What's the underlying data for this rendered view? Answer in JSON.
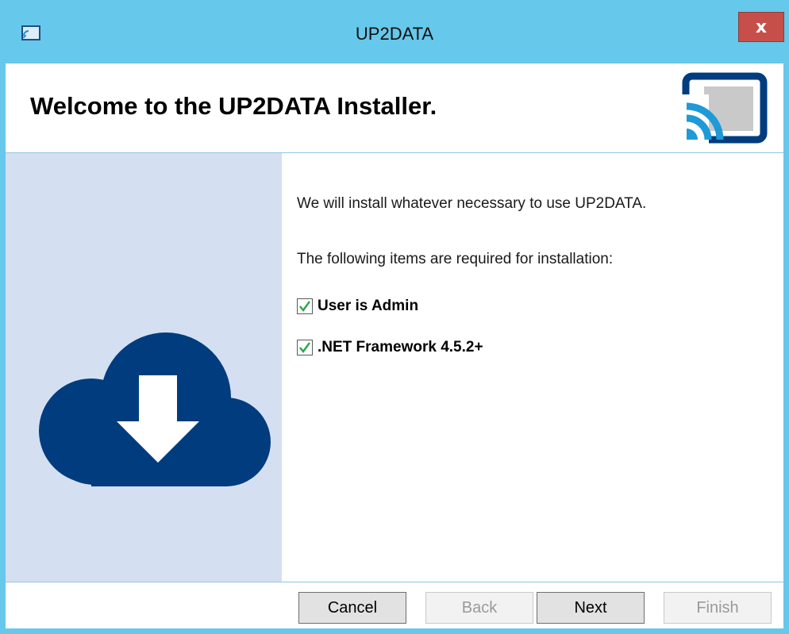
{
  "window": {
    "title": "UP2DATA",
    "close_label": "x",
    "accent_color": "#66c8ea"
  },
  "header": {
    "title": "Welcome to the UP2DATA Installer.",
    "logo_icon": "cast-screen-icon"
  },
  "side_panel": {
    "illustration_icon": "cloud-download-icon",
    "background_color": "#d4e0f1",
    "icon_color": "#013c7e"
  },
  "content": {
    "intro": "We will install whatever necessary to use UP2DATA.",
    "requirements_heading": "The following items are required for installation:",
    "requirements": [
      {
        "label": "User is Admin",
        "checked": true
      },
      {
        "label": ".NET Framework 4.5.2+",
        "checked": true
      }
    ]
  },
  "footer": {
    "buttons": [
      {
        "label": "Cancel",
        "enabled": true
      },
      {
        "label": "Back",
        "enabled": false
      },
      {
        "label": "Next",
        "enabled": true
      },
      {
        "label": "Finish",
        "enabled": false
      }
    ]
  }
}
